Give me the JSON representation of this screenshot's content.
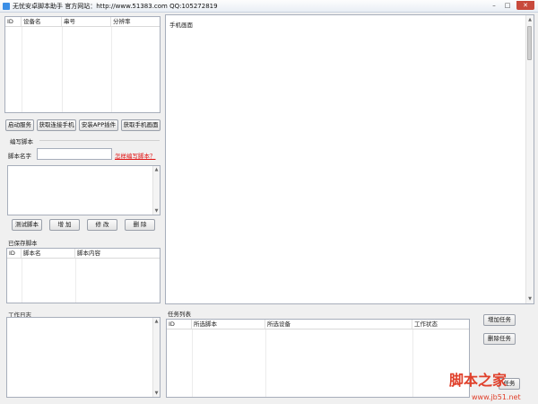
{
  "window": {
    "title": "无忧安卓脚本助手  官方网站：http://www.51383.com   QQ:105272819",
    "controls": [
      "–",
      "□",
      "✕"
    ]
  },
  "devices_table": {
    "columns": [
      "ID",
      "设备名",
      "串号",
      "分辨率"
    ]
  },
  "device_buttons": {
    "start_service": "启动服务",
    "get_connected_phones": "获取连接手机",
    "install_app_plugin": "安装APP插件",
    "get_phone_screen": "获取手机画面"
  },
  "script_editor": {
    "section_title": "编写脚本",
    "name_label": "脚本名字",
    "name_value": "",
    "help_link": "怎样编写脚本？",
    "content_value": ""
  },
  "script_buttons": {
    "test": "测试脚本",
    "add": "增 加",
    "edit": "修 改",
    "delete": "删 除"
  },
  "saved_scripts": {
    "section_title": "已保存脚本",
    "columns": [
      "ID",
      "脚本名",
      "脚本内容"
    ]
  },
  "work_log": {
    "section_title": "工作日志",
    "content": ""
  },
  "phone_screen": {
    "label": "手机画面"
  },
  "tasks": {
    "section_title": "任务列表",
    "columns": [
      "ID",
      "所选脚本",
      "所选设备",
      "工作状态"
    ],
    "add_button": "增加任务",
    "delete_button": "删除任务",
    "hidden_button_fragment": "任务"
  },
  "watermark": {
    "main": "脚本之家",
    "url": "www.jb51.net"
  }
}
